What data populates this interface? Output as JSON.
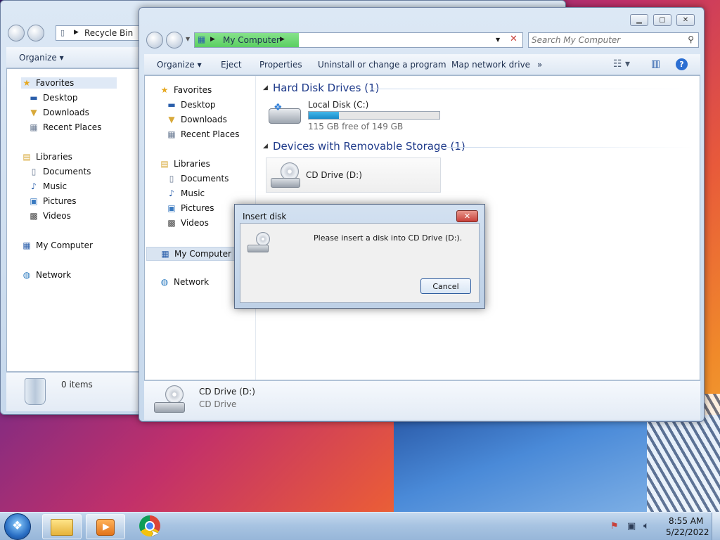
{
  "back_window": {
    "address": "Recycle Bin",
    "organize": "Organize",
    "nav": [
      {
        "label": "Favorites",
        "icon": "favorites-star-icon",
        "glyph": "★"
      },
      {
        "label": "Desktop",
        "icon": "desktop-icon",
        "glyph": "▬"
      },
      {
        "label": "Downloads",
        "icon": "downloads-folder-icon",
        "glyph": "▼"
      },
      {
        "label": "Recent Places",
        "icon": "recent-places-icon",
        "glyph": "▦"
      },
      {
        "label": "Libraries",
        "icon": "libraries-icon",
        "glyph": "▤"
      },
      {
        "label": "Documents",
        "icon": "documents-icon",
        "glyph": "▯"
      },
      {
        "label": "Music",
        "icon": "music-icon",
        "glyph": "♪"
      },
      {
        "label": "Pictures",
        "icon": "pictures-icon",
        "glyph": "▣"
      },
      {
        "label": "Videos",
        "icon": "videos-icon",
        "glyph": "▩"
      },
      {
        "label": "My Computer",
        "icon": "computer-icon",
        "glyph": "▦"
      },
      {
        "label": "Network",
        "icon": "network-icon",
        "glyph": "◍"
      }
    ],
    "status": "0 items"
  },
  "main_window": {
    "address": "My Computer",
    "search_placeholder": "Search My Computer",
    "toolbar": {
      "organize": "Organize",
      "eject": "Eject",
      "properties": "Properties",
      "uninstall": "Uninstall or change a program",
      "map_drive": "Map network drive",
      "more": "»"
    },
    "nav": [
      {
        "label": "Favorites",
        "icon": "favorites-star-icon",
        "glyph": "★"
      },
      {
        "label": "Desktop",
        "icon": "desktop-icon",
        "glyph": "▬"
      },
      {
        "label": "Downloads",
        "icon": "downloads-folder-icon",
        "glyph": "▼"
      },
      {
        "label": "Recent Places",
        "icon": "recent-places-icon",
        "glyph": "▦"
      },
      {
        "label": "Libraries",
        "icon": "libraries-icon",
        "glyph": "▤"
      },
      {
        "label": "Documents",
        "icon": "documents-icon",
        "glyph": "▯"
      },
      {
        "label": "Music",
        "icon": "music-icon",
        "glyph": "♪"
      },
      {
        "label": "Pictures",
        "icon": "pictures-icon",
        "glyph": "▣"
      },
      {
        "label": "Videos",
        "icon": "videos-icon",
        "glyph": "▩"
      },
      {
        "label": "My Computer",
        "icon": "computer-icon",
        "glyph": "▦"
      },
      {
        "label": "Network",
        "icon": "network-icon",
        "glyph": "◍"
      }
    ],
    "section_hdd": "Hard Disk Drives (1)",
    "drive_c": {
      "name": "Local Disk (C:)",
      "free": "115 GB free of 149 GB",
      "used_fraction": 0.23
    },
    "section_removable": "Devices with Removable Storage (1)",
    "drive_d": {
      "name": "CD Drive (D:)"
    },
    "details": {
      "name": "CD Drive (D:)",
      "type": "CD Drive"
    }
  },
  "dialog": {
    "title": "Insert disk",
    "message": "Please insert a disk into CD Drive (D:).",
    "cancel": "Cancel"
  },
  "taskbar": {
    "time": "8:55 AM",
    "date": "5/22/2022"
  },
  "colors": {
    "accent": "#1e3a8a",
    "drive_bar": "#26a0da",
    "close_red": "#c8403a"
  }
}
